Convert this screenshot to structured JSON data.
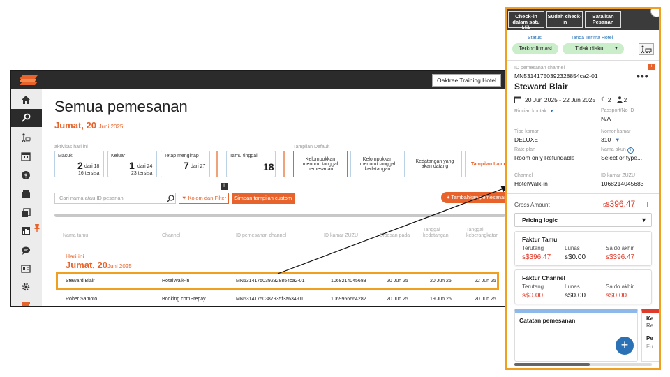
{
  "app": {
    "hotel_button": "Oaktree Training Hotel"
  },
  "page": {
    "title": "Semua pemesanan",
    "date_day": "Jumat, 20",
    "date_month": "Juni 2025"
  },
  "stats": {
    "section_label": "aktivitas hari ini",
    "masuk": {
      "label": "Masuk",
      "value": "2",
      "of": "dari 18",
      "remaining": "16 tersisa"
    },
    "keluar": {
      "label": "Keluar",
      "value": "1",
      "of": "dari 24",
      "remaining": "23 tersisa"
    },
    "tetap": {
      "label": "Tetap menginap",
      "value": "7",
      "of": "dari 27"
    },
    "tamu": {
      "label": "Tamu tinggal",
      "value": "18"
    }
  },
  "views": {
    "section_label": "Tampilan Default",
    "items": [
      "Kelompokkan menurut tanggal pemesanan",
      "Kelompokkan menurut tanggal kedatangan",
      "Kedatangan yang akan datang",
      "Tampilan Lainnya"
    ]
  },
  "toolbar": {
    "search_placeholder": "Cari nama atau ID pesanan",
    "filter_label": "Kolom dan Filter",
    "save_label": "Simpan tampilan custom",
    "info": "i",
    "add_label": "Tambahkan pemesanan"
  },
  "table": {
    "headers": [
      "Nama tamu",
      "Channel",
      "ID pemesanan channel",
      "ID kamar ZUZU",
      "Dipesan pada",
      "Tanggal kedatangan",
      "Tanggal keberangkatan"
    ],
    "group_label": "Hari ini",
    "group_day": "Jumat, 20",
    "group_month": "Juni 2025",
    "rows": [
      [
        "Steward Blair",
        "HotelWalk-in",
        "MN53141750392328854ca2-01",
        "1068214045683",
        "20 Jun 25",
        "20 Jun 25",
        "22 Jun 25"
      ],
      [
        "Rober Samoto",
        "Booking.comPrepay",
        "MN53141750387935f3a634-01",
        "1069956664282",
        "20 Jun 25",
        "19 Jun 25",
        "20 Jun 25"
      ]
    ]
  },
  "panel": {
    "tabs": [
      "Check-in dalam satu klik",
      "Sudah check-in",
      "Batalkan Pesanan"
    ],
    "status_label": "Status",
    "status_value": "Terkonfirmasi",
    "receipt_label": "Tanda Terima Hotel",
    "receipt_value": "Tidak diakui",
    "channel_id_label": "ID pemesanan channel",
    "channel_id": "MN53141750392328854ca2-01",
    "badge": "i",
    "more": "•••",
    "guest_name": "Steward Blair",
    "dates": "20 Jun 2025 - 22 Jun 2025",
    "nights": "2",
    "guests": "2",
    "rincian_label": "Rincian kontak",
    "passport_label": "Passport/No ID",
    "passport_value": "N/A",
    "room_type_label": "Tipe kamar",
    "room_type_value": "DELUXE",
    "room_no_label": "Nomor kamar",
    "room_no_value": "310",
    "rate_label": "Rate plan",
    "rate_value": "Room only Refundable",
    "account_label": "Nama akun",
    "account_placeholder": "Select or type...",
    "channel_label": "Channel",
    "channel_value": "HotelWalk-in",
    "zuzu_label": "ID kamar ZUZU",
    "zuzu_value": "1068214045683",
    "gross_label": "Gross Amount",
    "gross_currency": "s$",
    "gross_value": "396.47",
    "pricing_label": "Pricing logic",
    "guest_invoice": {
      "title": "Faktur Tamu",
      "labels": [
        "Terutang",
        "Lunas",
        "Saldo akhir"
      ],
      "values": [
        "s$396.47",
        "s$0.00",
        "s$396.47"
      ]
    },
    "channel_invoice": {
      "title": "Faktur Channel",
      "labels": [
        "Terutang",
        "Lunas",
        "Saldo akhir"
      ],
      "values": [
        "s$0.00",
        "s$0.00",
        "s$0.00"
      ]
    },
    "notes_title": "Catatan pemesanan",
    "add_note": "+",
    "card2_lines": [
      "Ke",
      "Re",
      "Pe",
      "Fu"
    ]
  },
  "colors": {
    "accent": "#e8632b",
    "highlight": "#f0a020",
    "dark": "#2b2b2b",
    "link": "#2a72b5",
    "money_red": "#e03a2a"
  }
}
